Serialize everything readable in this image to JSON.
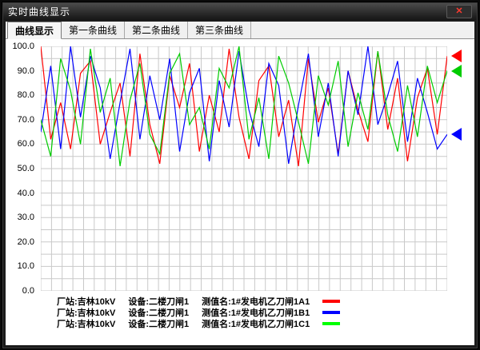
{
  "window": {
    "title": "实时曲线显示",
    "close_label": "✕"
  },
  "tabs": [
    "曲线显示",
    "第一条曲线",
    "第二条曲线",
    "第三条曲线"
  ],
  "chart_data": {
    "type": "line",
    "title": "",
    "xlabel": "",
    "ylabel": "",
    "ylim": [
      0,
      100
    ],
    "ytick_labels": [
      "100.0",
      "90.0",
      "80.0",
      "70.0",
      "60.0",
      "50.0",
      "40.0",
      "30.0",
      "20.0",
      "10.0",
      "0.0"
    ],
    "grid": {
      "x_divisions": 38,
      "y_divisions": 20,
      "color": "#c9c9c9"
    },
    "legend_position": "bottom",
    "series": [
      {
        "name": "1#发电机乙刀闸1A1",
        "color": "#ff0000",
        "values": [
          100,
          62,
          77,
          58,
          89,
          94,
          60,
          73,
          85,
          55,
          97,
          68,
          52,
          88,
          75,
          93,
          57,
          80,
          65,
          99,
          71,
          54,
          86,
          92,
          63,
          78,
          51,
          95,
          69,
          83,
          56,
          90,
          74,
          61,
          98,
          66,
          87,
          53,
          79,
          91,
          64,
          96
        ]
      },
      {
        "name": "1#发电机乙刀闸1B1",
        "color": "#0000ff",
        "values": [
          65,
          92,
          58,
          100,
          71,
          96,
          83,
          54,
          77,
          99,
          62,
          88,
          70,
          95,
          57,
          81,
          91,
          53,
          86,
          67,
          98,
          74,
          59,
          93,
          84,
          52,
          76,
          97,
          63,
          85,
          55,
          90,
          72,
          100,
          68,
          80,
          94,
          61,
          87,
          73,
          58,
          64
        ]
      },
      {
        "name": "1#发电机乙刀闸1C1",
        "color": "#00cc00",
        "values": [
          70,
          55,
          95,
          82,
          60,
          99,
          73,
          87,
          51,
          78,
          93,
          64,
          56,
          89,
          97,
          68,
          75,
          58,
          91,
          83,
          100,
          62,
          79,
          54,
          96,
          85,
          69,
          52,
          88,
          76,
          94,
          59,
          81,
          66,
          98,
          72,
          57,
          84,
          63,
          92,
          77,
          90
        ]
      }
    ],
    "markers": [
      {
        "color": "#ff0000",
        "value": 96
      },
      {
        "color": "#00cc00",
        "value": 90
      },
      {
        "color": "#0000ff",
        "value": 64
      }
    ]
  },
  "legend": {
    "rows": [
      {
        "station": "厂站:吉林10kV",
        "device": "设备:二楼刀闸1",
        "measure": "测值名:1#发电机乙刀闸1A1",
        "color": "#ff0000"
      },
      {
        "station": "厂站:吉林10kV",
        "device": "设备:二楼刀闸1",
        "measure": "测值名:1#发电机乙刀闸1B1",
        "color": "#0000ff"
      },
      {
        "station": "厂站:吉林10kV",
        "device": "设备:二楼刀闸1",
        "measure": "测值名:1#发电机乙刀闸1C1",
        "color": "#00ff00"
      }
    ]
  }
}
